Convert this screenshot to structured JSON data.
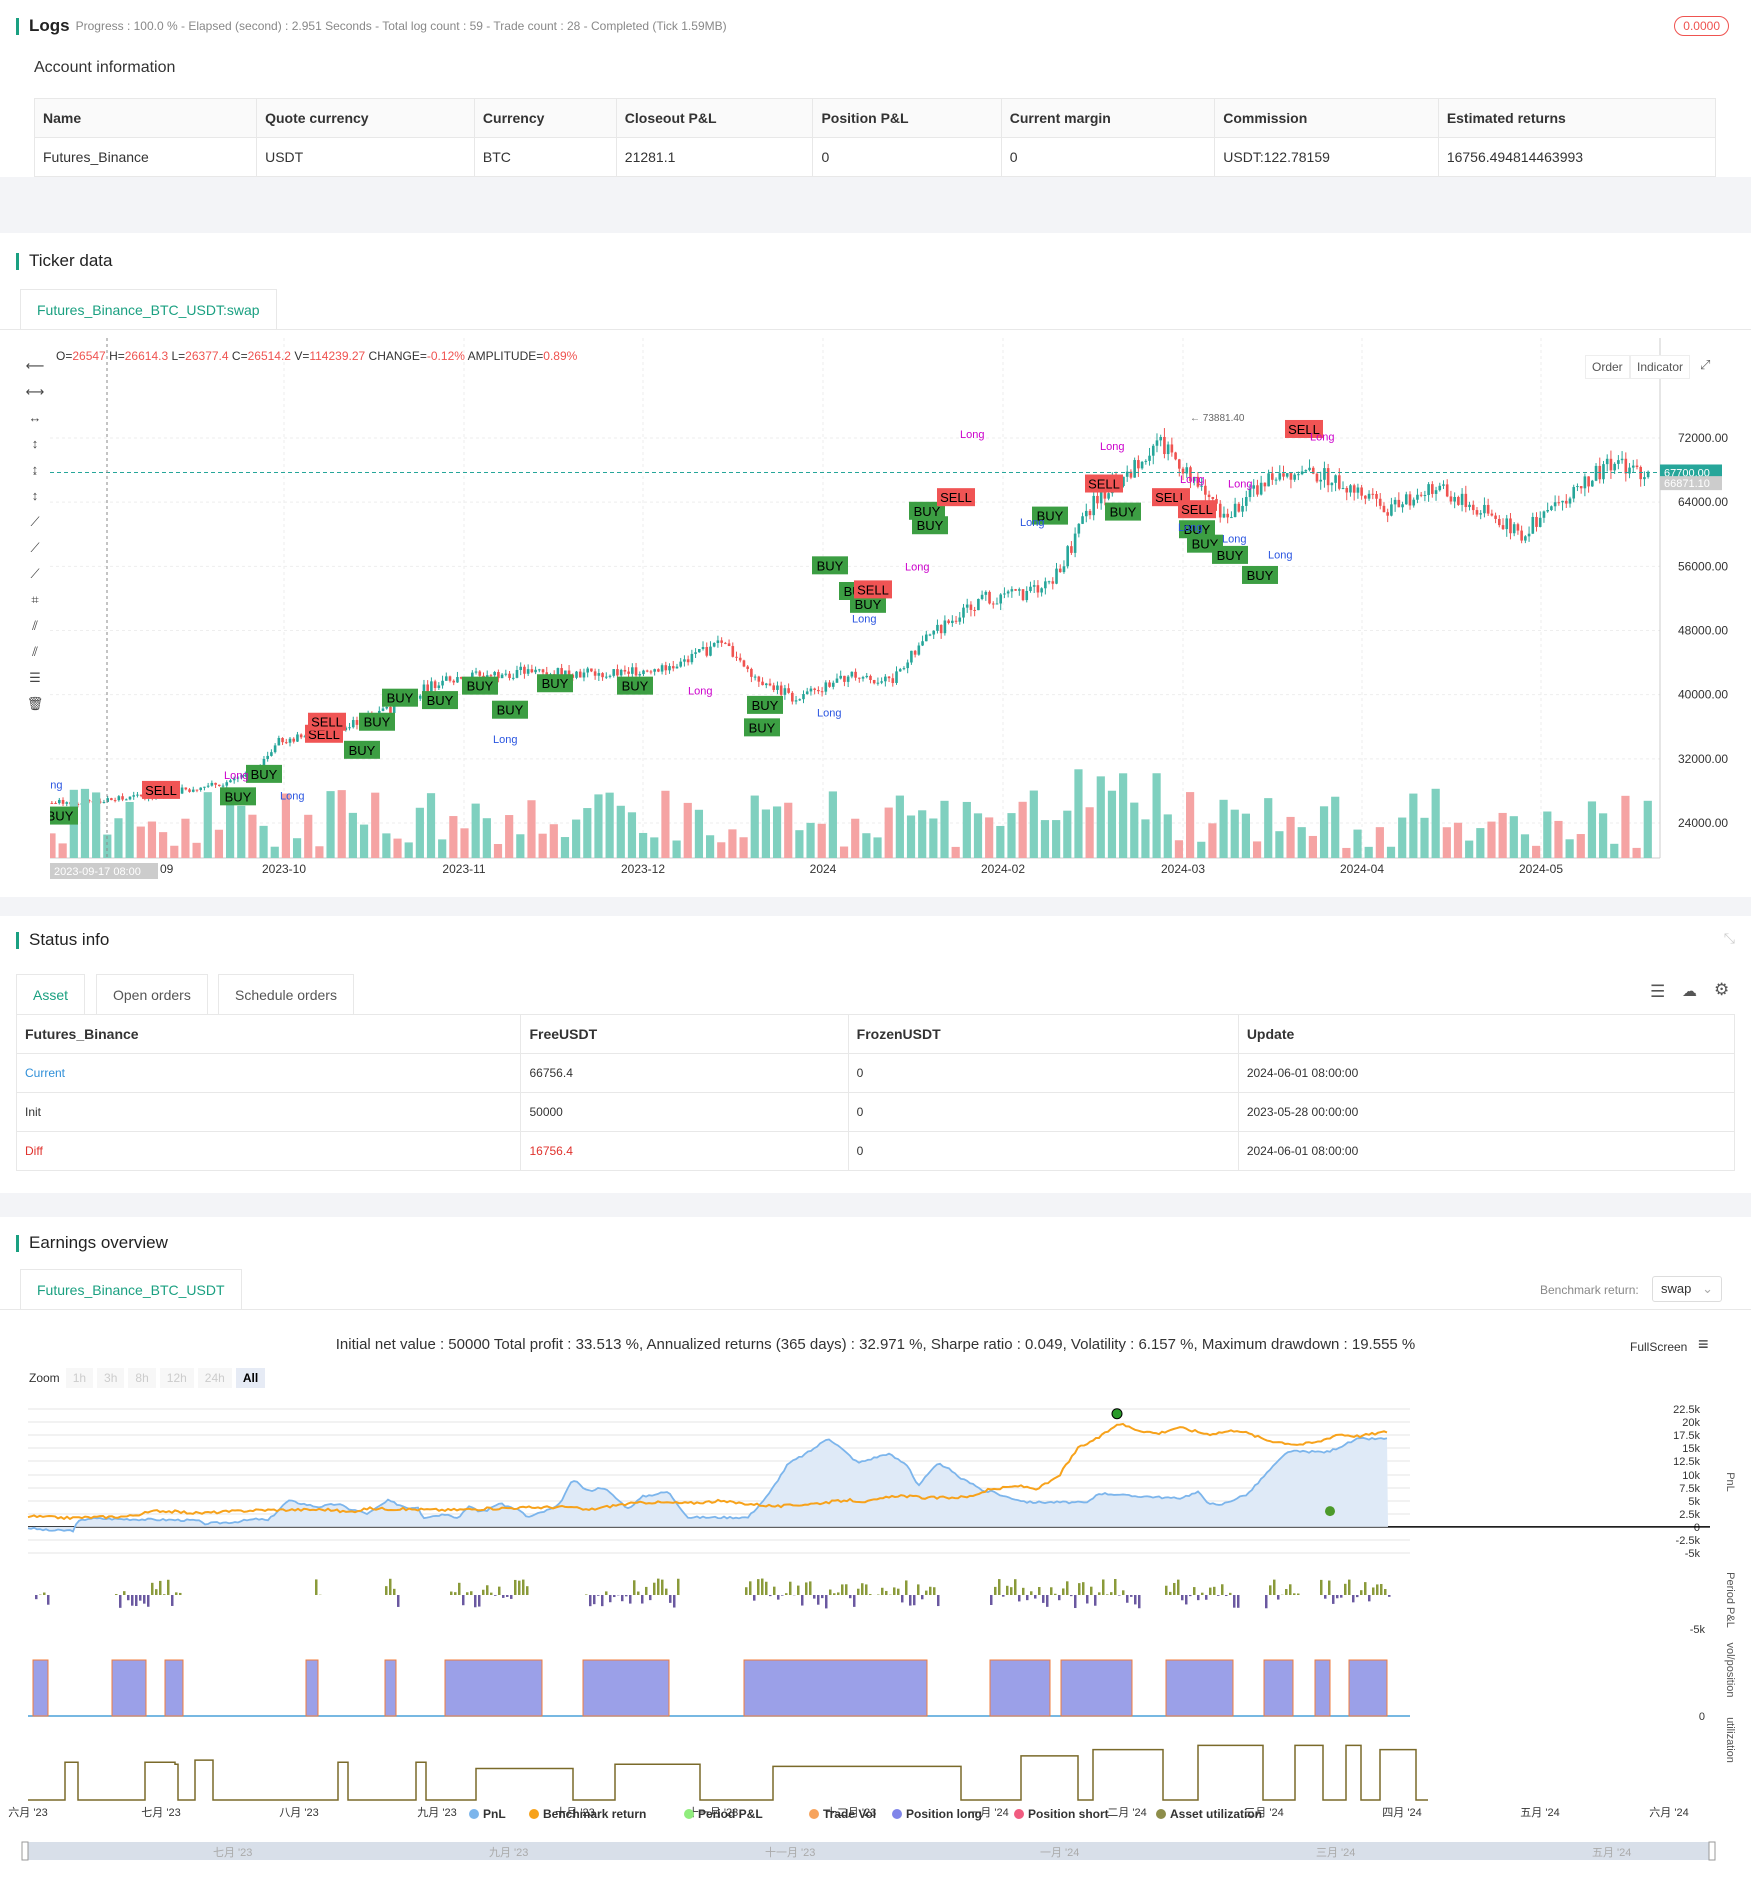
{
  "logs": {
    "title": "Logs",
    "status": "Progress : 100.0 % - Elapsed (second) : 2.951 Seconds - Total log count : 59 - Trade count : 28 - Completed (Tick 1.59MB)",
    "badge": "0.0000"
  },
  "account": {
    "title": "Account information",
    "headers": [
      "Name",
      "Quote currency",
      "Currency",
      "Closeout P&L",
      "Position P&L",
      "Current margin",
      "Commission",
      "Estimated returns"
    ],
    "row": [
      "Futures_Binance",
      "USDT",
      "BTC",
      "21281.1",
      "0",
      "0",
      "USDT:122.78159",
      "16756.494814463993"
    ]
  },
  "ticker": {
    "title": "Ticker data",
    "tab": "Futures_Binance_BTC_USDT:swap",
    "ohlc": {
      "o_label": "O=",
      "o": "26547",
      "h_label": "H=",
      "h": "26614.3",
      "l_label": "L=",
      "l": "26377.4",
      "c_label": "C=",
      "c": "26514.2",
      "v_label": "V=",
      "v": "114239.27",
      "chg_label": "CHANGE=",
      "chg": "-0.12%",
      "amp_label": "AMPLITUDE=",
      "amp": "0.89%"
    },
    "buttons": {
      "order": "Order",
      "indicator": "Indicator"
    },
    "yticks": [
      "72000.00",
      "64000.00",
      "56000.00",
      "48000.00",
      "40000.00",
      "32000.00",
      "24000.00"
    ],
    "xticks": [
      "2023-10",
      "2023-11",
      "2023-12",
      "2024",
      "2024-02",
      "2024-03",
      "2024-04",
      "2024-05"
    ],
    "crosshair_date": "2023-09-17 08:00",
    "crosshair_suffix": "09",
    "last_price": "67700.00",
    "price_low": "66871.10",
    "max_label": "73881.40",
    "signal_labels": {
      "buy": "BUY",
      "sell": "SELL",
      "long": "Long",
      "one": "1"
    },
    "colors": {
      "up": "#26a69a",
      "down": "#ef5350",
      "buy": "#3c9e43",
      "sell": "#f05454"
    }
  },
  "status": {
    "title": "Status info",
    "tabs": [
      "Asset",
      "Open orders",
      "Schedule orders"
    ],
    "headers": [
      "Futures_Binance",
      "FreeUSDT",
      "FrozenUSDT",
      "Update"
    ],
    "rows": [
      [
        "Current",
        "66756.4",
        "0",
        "2024-06-01 08:00:00"
      ],
      [
        "Init",
        "50000",
        "0",
        "2023-05-28 00:00:00"
      ],
      [
        "Diff",
        "16756.4",
        "0",
        "2024-06-01 08:00:00"
      ]
    ]
  },
  "earnings": {
    "title": "Earnings overview",
    "tab": "Futures_Binance_BTC_USDT",
    "benchmark_label": "Benchmark return:",
    "benchmark_value": "swap",
    "summary": "Initial net value : 50000 Total profit : 33.513 %, Annualized returns (365 days) : 32.971 %, Sharpe ratio : 0.049, Volatility : 6.157 %, Maximum drawdown : 19.555 %",
    "fullscreen": "FullScreen",
    "zoom_label": "Zoom",
    "zoom": [
      "1h",
      "3h",
      "8h",
      "12h",
      "24h",
      "All"
    ],
    "pnl_ticks": [
      "22.5k",
      "20k",
      "17.5k",
      "15k",
      "12.5k",
      "10k",
      "7.5k",
      "5k",
      "2.5k",
      "0",
      "-2.5k",
      "-5k"
    ],
    "period_tick": "-5k",
    "pos_tick": "0",
    "axis_names": [
      "PnL",
      "Period P&L",
      "vol/position",
      "utilization"
    ],
    "months": [
      "六月 '23",
      "七月 '23",
      "八月 '23",
      "九月 '23",
      "十月 '23",
      "十一月 '23",
      "十二月 '23",
      "一月 '24",
      "二月 '24",
      "三月 '24",
      "四月 '24",
      "五月 '24",
      "六月 '24"
    ],
    "nav_months": [
      "七月 '23",
      "九月 '23",
      "十一月 '23",
      "一月 '24",
      "三月 '24",
      "五月 '24"
    ],
    "legend": [
      {
        "name": "PnL",
        "color": "#7cb5ec"
      },
      {
        "name": "Benchmark return",
        "color": "#f7a21b"
      },
      {
        "name": "Period P&L",
        "color": "#90ed7d"
      },
      {
        "name": "Trade Vol",
        "color": "#f7a35c"
      },
      {
        "name": "Position long",
        "color": "#8085e9"
      },
      {
        "name": "Position short",
        "color": "#f15c80"
      },
      {
        "name": "Asset utilization",
        "color": "#8d8d4a"
      }
    ]
  }
}
